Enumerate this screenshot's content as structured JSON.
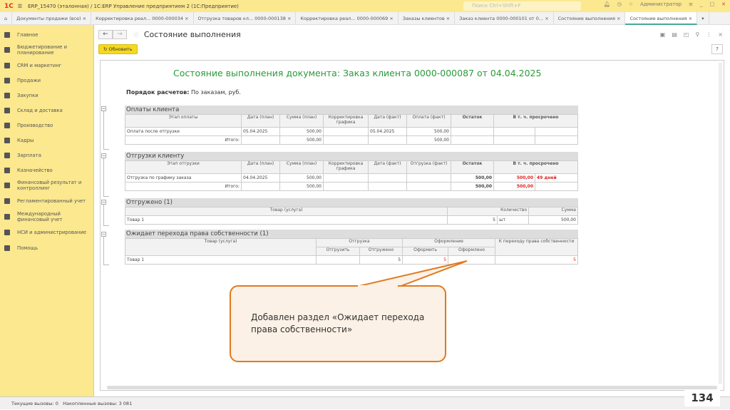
{
  "window": {
    "title": "ERP_15470 (эталонная) / 1С:ERP Управление предприятием 2  (1С:Предприятие)",
    "search_placeholder": "Поиск Ctrl+Shift+F",
    "user": "Администратор"
  },
  "tabs": [
    "Документы продажи (все)",
    "Корректировка реал... 0000-000034",
    "Отгрузка товаров кл... 0000-000138",
    "Корректировка реал... 0000-000069",
    "Заказы клиентов",
    "Заказ клиента 0000-000101 от 0...",
    "Состояние выполнения",
    "Состояние выполнения"
  ],
  "sidebar": [
    "Главное",
    "Бюджетирование и планирование",
    "CRM и маркетинг",
    "Продажи",
    "Закупки",
    "Склад и доставка",
    "Производство",
    "Кадры",
    "Зарплата",
    "Казначейство",
    "Финансовый результат и контроллинг",
    "Регламентированный учет",
    "Международный финансовый учет",
    "НСИ и администрирование",
    "Помощь"
  ],
  "page": {
    "title": "Состояние выполнения",
    "refresh": "Обновить",
    "help": "?"
  },
  "report": {
    "title": "Состояние выполнения документа: Заказ клиента 0000-000087 от 04.04.2025",
    "order_label": "Порядок расчетов:",
    "order_value": "По заказам, руб.",
    "payments": {
      "title": "Оплаты клиента",
      "headers": [
        "Этап оплаты",
        "Дата (план)",
        "Сумма (план)",
        "Корректировка графика",
        "Дата (факт)",
        "Оплата (факт)",
        "Остаток",
        "В т. ч. просрочено"
      ],
      "row": [
        "Оплата после отгрузки",
        "05.04.2025",
        "500,00",
        "",
        "05.04.2025",
        "500,00",
        "",
        "",
        ""
      ],
      "total": [
        "Итого:",
        "",
        "500,00",
        "",
        "",
        "500,00",
        "",
        "",
        ""
      ]
    },
    "shipments": {
      "title": "Отгрузки клиенту",
      "headers": [
        "Этап отгрузки",
        "Дата (план)",
        "Сумма (план)",
        "Корректировка графика",
        "Дата (факт)",
        "Отгрузка (факт)",
        "Остаток",
        "В т. ч. просрочено"
      ],
      "row": [
        "Отгрузка по графику заказа",
        "04.04.2025",
        "500,00",
        "",
        "",
        "",
        "500,00",
        "500,00",
        "49 дней"
      ],
      "total": [
        "Итого:",
        "",
        "500,00",
        "",
        "",
        "",
        "500,00",
        "500,00",
        ""
      ]
    },
    "shipped": {
      "title": "Отгружено (1)",
      "headers": [
        "Товар (услуга)",
        "Количество",
        "Сумма"
      ],
      "row": [
        "Товар 1",
        "5",
        "шт",
        "500,00"
      ]
    },
    "ownership": {
      "title": "Ожидает перехода права собственности (1)",
      "headers": [
        "Товар (услуга)",
        "Отгрузка",
        "Оформление",
        "К переходу права собственности"
      ],
      "subheaders": [
        "Отгрузить",
        "Отгружено",
        "Оформить",
        "Оформлено"
      ],
      "row": [
        "Товар 1",
        "",
        "5",
        "5",
        "",
        "5"
      ]
    }
  },
  "callout": "Добавлен раздел «Ожидает перехода права собственности»",
  "status": {
    "current": "Текущие вызовы: 0",
    "accumulated": "Накопленные вызовы: 3 081"
  },
  "slide_number": "134",
  "colors": {
    "accent": "#fbe88f",
    "title_green": "#2a9a3a",
    "overdue": "#e02020",
    "callout_border": "#e07a20"
  }
}
